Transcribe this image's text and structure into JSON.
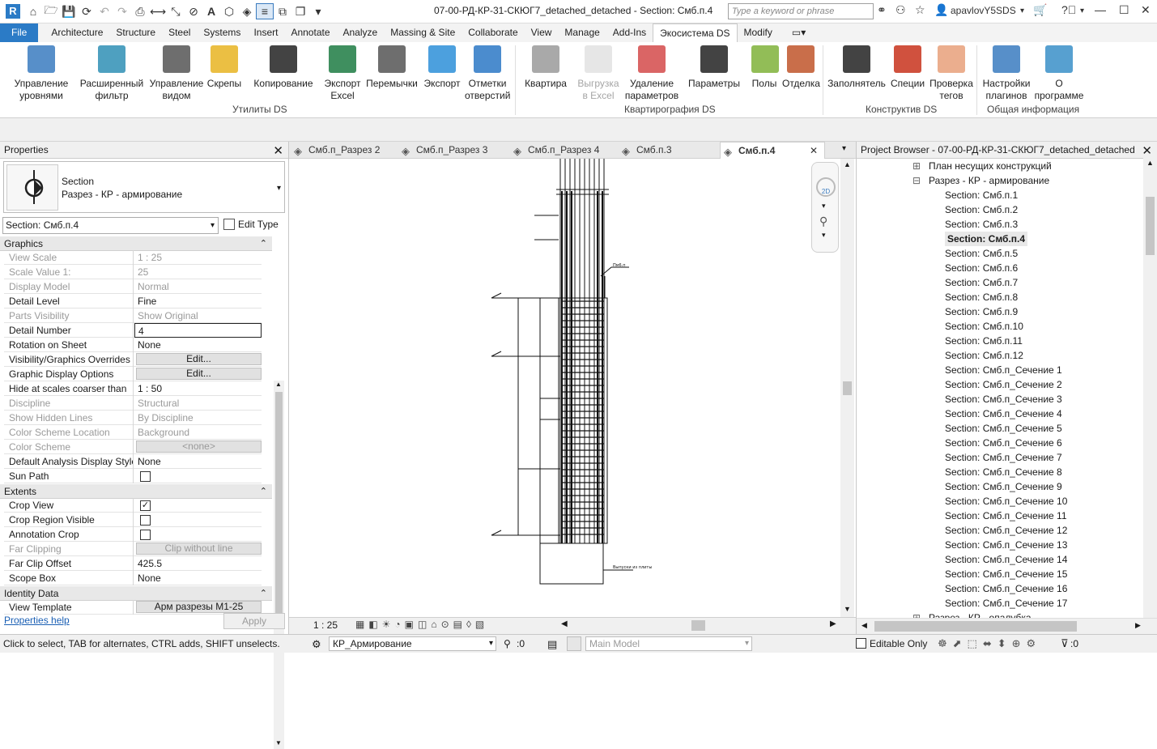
{
  "window": {
    "title": "07-00-РД-КР-31-СКЮГ7_detached_detached - Section: Смб.п.4",
    "search_placeholder": "Type a keyword or phrase",
    "user": "apavlovY5SDS",
    "app_icon_letter": "R"
  },
  "ribbon_tabs": [
    "File",
    "Architecture",
    "Structure",
    "Steel",
    "Systems",
    "Insert",
    "Annotate",
    "Analyze",
    "Massing & Site",
    "Collaborate",
    "View",
    "Manage",
    "Add-Ins",
    "Экосистема DS",
    "Modify"
  ],
  "ribbon": {
    "buttons": [
      {
        "label1": "Управление",
        "label2": "уровнями",
        "icon": "levels-icon",
        "color": "#3a7bbf",
        "disabled": false
      },
      {
        "label1": "Расширенный",
        "label2": "фильтр",
        "icon": "filter-icon",
        "color": "#2f8fb5",
        "disabled": false
      },
      {
        "label1": "Управление",
        "label2": "видом",
        "icon": "view-manage-icon",
        "color": "#555555",
        "disabled": false
      },
      {
        "label1": "Скрепы",
        "label2": "",
        "icon": "pin-icon",
        "color": "#e8b422",
        "disabled": false
      },
      {
        "label1": "Копирование",
        "label2": "",
        "icon": "copy-icon",
        "color": "#222222",
        "disabled": false
      },
      {
        "label1": "Экспорт",
        "label2": "Excel",
        "icon": "excel-icon",
        "color": "#1d7b43",
        "disabled": false
      },
      {
        "label1": "Перемычки",
        "label2": "",
        "icon": "lintel-icon",
        "color": "#555555",
        "disabled": false
      },
      {
        "label1": "Экспорт",
        "label2": "",
        "icon": "printer-icon",
        "color": "#2d8fd8",
        "disabled": false
      },
      {
        "label1": "Отметки",
        "label2": "отверстий",
        "icon": "marks-icon",
        "color": "#2b78c6",
        "disabled": false
      },
      {
        "label1": "Квартира",
        "label2": "",
        "icon": "apartment-icon",
        "color": "#9a9a9a",
        "disabled": false
      },
      {
        "label1": "Выгрузка",
        "label2": "в Excel",
        "icon": "table-icon",
        "color": "#c8c8c8",
        "disabled": true
      },
      {
        "label1": "Удаление",
        "label2": "параметров",
        "icon": "eraser-icon",
        "color": "#d34a4a",
        "disabled": false
      },
      {
        "label1": "Параметры",
        "label2": "",
        "icon": "refresh-icon",
        "color": "#222222",
        "disabled": false
      },
      {
        "label1": "Полы",
        "label2": "",
        "icon": "floors-icon",
        "color": "#7fb23a",
        "disabled": false
      },
      {
        "label1": "Отделка",
        "label2": "",
        "icon": "finish-icon",
        "color": "#c0552a",
        "disabled": false
      },
      {
        "label1": "Заполнятель",
        "label2": "",
        "icon": "filler-icon",
        "color": "#222222",
        "disabled": false
      },
      {
        "label1": "Специи",
        "label2": "",
        "icon": "pepper-icon",
        "color": "#c8321c",
        "disabled": false
      },
      {
        "label1": "Проверка",
        "label2": "тегов",
        "icon": "tag-check-icon",
        "color": "#e8a07a",
        "disabled": false
      },
      {
        "label1": "Настройки",
        "label2": "плагинов",
        "icon": "sliders-icon",
        "color": "#3a7bbf",
        "disabled": false
      },
      {
        "label1": "О",
        "label2": "программе",
        "icon": "cube-icon",
        "color": "#3a8fc8",
        "disabled": false
      }
    ],
    "panels": [
      "Утилиты DS",
      "Квартирография DS",
      "Конструктив DS",
      "Общая информация"
    ]
  },
  "properties": {
    "header": "Properties",
    "type_name": "Section",
    "type_family": "Разрез - КР - армирование",
    "instance_selector": "Section: Смб.п.4",
    "edit_type": "Edit Type",
    "groups": {
      "graphics": "Graphics",
      "extents": "Extents",
      "identity": "Identity Data"
    },
    "rows": [
      {
        "k": "View Scale",
        "v": "1 : 25",
        "dim": true
      },
      {
        "k": "Scale Value    1:",
        "v": "25",
        "dim": true
      },
      {
        "k": "Display Model",
        "v": "Normal",
        "dim": true
      },
      {
        "k": "Detail Level",
        "v": "Fine",
        "dim": false
      },
      {
        "k": "Parts Visibility",
        "v": "Show Original",
        "dim": true
      },
      {
        "k": "Detail Number",
        "v": "4",
        "dim": false
      },
      {
        "k": "Rotation on Sheet",
        "v": "None",
        "dim": false
      },
      {
        "k": "Visibility/Graphics Overrides",
        "v": "Edit...",
        "dim": false
      },
      {
        "k": "Graphic Display Options",
        "v": "Edit...",
        "dim": false
      },
      {
        "k": "Hide at scales coarser than",
        "v": "1 : 50",
        "dim": false
      },
      {
        "k": "Discipline",
        "v": "Structural",
        "dim": true
      },
      {
        "k": "Show Hidden Lines",
        "v": "By Discipline",
        "dim": true
      },
      {
        "k": "Color Scheme Location",
        "v": "Background",
        "dim": true
      },
      {
        "k": "Color Scheme",
        "v": "<none>",
        "dim": true
      },
      {
        "k": "Default Analysis Display Style",
        "v": "None",
        "dim": false
      },
      {
        "k": "Sun Path",
        "v": "",
        "dim": false
      }
    ],
    "extent_rows": [
      {
        "k": "Crop View",
        "v": "✓",
        "dim": false
      },
      {
        "k": "Crop Region Visible",
        "v": "",
        "dim": false
      },
      {
        "k": "Annotation Crop",
        "v": "",
        "dim": false
      },
      {
        "k": "Far Clipping",
        "v": "Clip without line",
        "dim": true
      },
      {
        "k": "Far Clip Offset",
        "v": "425.5",
        "dim": false
      },
      {
        "k": "Scope Box",
        "v": "None",
        "dim": false
      }
    ],
    "identity_rows": [
      {
        "k": "View Template",
        "v": "Арм разрезы М1-25",
        "dim": false
      }
    ],
    "help": "Properties help",
    "apply": "Apply"
  },
  "view_tabs": [
    "Смб.п_Разрез 2",
    "Смб.п_Разрез 3",
    "Смб.п_Разрез 4",
    "Смб.п.3",
    "Смб.п.4"
  ],
  "view": {
    "scale": "1 : 25",
    "drawing_labels": [
      "Пм6.п",
      "Выпуски из плиты"
    ],
    "nav_2d": "2D"
  },
  "project_browser": {
    "header": "Project Browser - 07-00-РД-КР-31-СКЮГ7_detached_detached",
    "items": [
      "План несущих конструкций",
      "Разрез - КР - армирование",
      "Section: Смб.п.1",
      "Section: Смб.п.2",
      "Section: Смб.п.3",
      "Section: Смб.п.4",
      "Section: Смб.п.5",
      "Section: Смб.п.6",
      "Section: Смб.п.7",
      "Section: Смб.п.8",
      "Section: Смб.п.9",
      "Section: Смб.п.10",
      "Section: Смб.п.11",
      "Section: Смб.п.12",
      "Section: Смб.п_Сечение 1",
      "Section: Смб.п_Сечение 2",
      "Section: Смб.п_Сечение 3",
      "Section: Смб.п_Сечение 4",
      "Section: Смб.п_Сечение 5",
      "Section: Смб.п_Сечение 6",
      "Section: Смб.п_Сечение 7",
      "Section: Смб.п_Сечение 8",
      "Section: Смб.п_Сечение 9",
      "Section: Смб.п_Сечение 10",
      "Section: Смб.п_Сечение 11",
      "Section: Смб.п_Сечение 12",
      "Section: Смб.п_Сечение 13",
      "Section: Смб.п_Сечение 14",
      "Section: Смб.п_Сечение 15",
      "Section: Смб.п_Сечение 16",
      "Section: Смб.п_Сечение 17",
      "Разрез - КР - опалубка"
    ]
  },
  "status": {
    "hint": "Click to select, TAB for alternates, CTRL adds, SHIFT unselects.",
    "workset": "КР_Армирование",
    "count": ":0",
    "model": "Main Model",
    "editable_only": "Editable Only",
    "filter_count": ":0"
  }
}
